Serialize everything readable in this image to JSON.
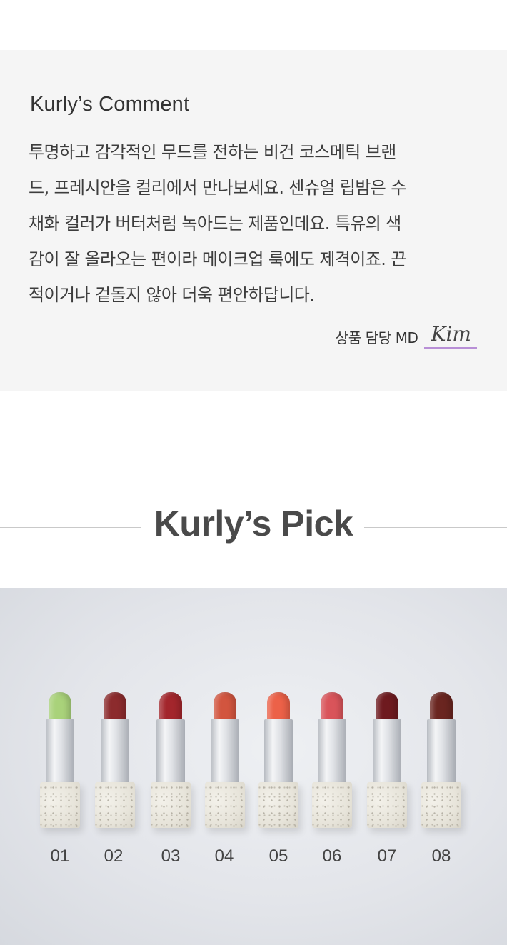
{
  "comment": {
    "title": "Kurly’s Comment",
    "body": "투명하고 감각적인 무드를 전하는 비건 코스메틱 브랜\n드, 프레시안을 컬리에서 만나보세요. 센슈얼 립밤은 수\n채화 컬러가 버터처럼 녹아드는 제품인데요. 특유의 색\n감이 잘 올라오는 편이라 메이크업 룩에도 제격이죠. 끈\n적이거나 겉돌지 않아 더욱 편안하답니다.",
    "signature_label": "상품 담당 MD",
    "signature_name": "Kim"
  },
  "pick": {
    "title": "Kurly’s Pick"
  },
  "colors": {
    "comment_bg": "#f5f5f5",
    "signature_underline": "#b88fd6"
  },
  "lipsticks": [
    {
      "number": "01",
      "color": "#a9d27a"
    },
    {
      "number": "02",
      "color": "#8c2b2d"
    },
    {
      "number": "03",
      "color": "#a3262c"
    },
    {
      "number": "04",
      "color": "#d2553f"
    },
    {
      "number": "05",
      "color": "#ec6148"
    },
    {
      "number": "06",
      "color": "#d9545a"
    },
    {
      "number": "07",
      "color": "#6e1a1f"
    },
    {
      "number": "08",
      "color": "#6a2520"
    }
  ]
}
